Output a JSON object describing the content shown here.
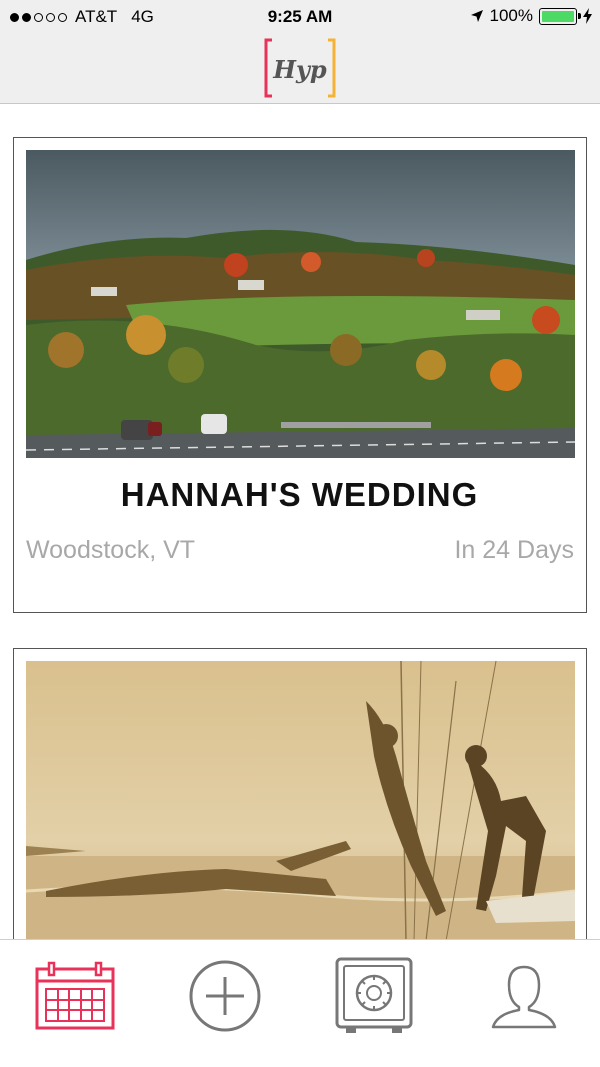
{
  "status_bar": {
    "carrier": "AT&T",
    "network": "4G",
    "time": "9:25 AM",
    "battery": "100%",
    "signal_bars_filled": 2,
    "signal_bars_total": 5
  },
  "header": {
    "logo_text": "Hyp",
    "logo_bracket_colors": [
      "#e8325a",
      "#f5b335"
    ]
  },
  "feed": {
    "events": [
      {
        "title": "HANNAH'S WEDDING",
        "location": "Woodstock, VT",
        "countdown": "In 24 Days",
        "image": "autumn-highway-landscape"
      },
      {
        "image": "sepia-people-diving-from-boat"
      }
    ]
  },
  "tab_bar": {
    "tabs": [
      {
        "name": "calendar",
        "icon": "calendar-icon",
        "active": true
      },
      {
        "name": "add",
        "icon": "plus-circle-icon",
        "active": false
      },
      {
        "name": "vault",
        "icon": "safe-icon",
        "active": false
      },
      {
        "name": "profile",
        "icon": "person-icon",
        "active": false
      }
    ],
    "active_color": "#e8325a",
    "inactive_color": "#777777"
  }
}
